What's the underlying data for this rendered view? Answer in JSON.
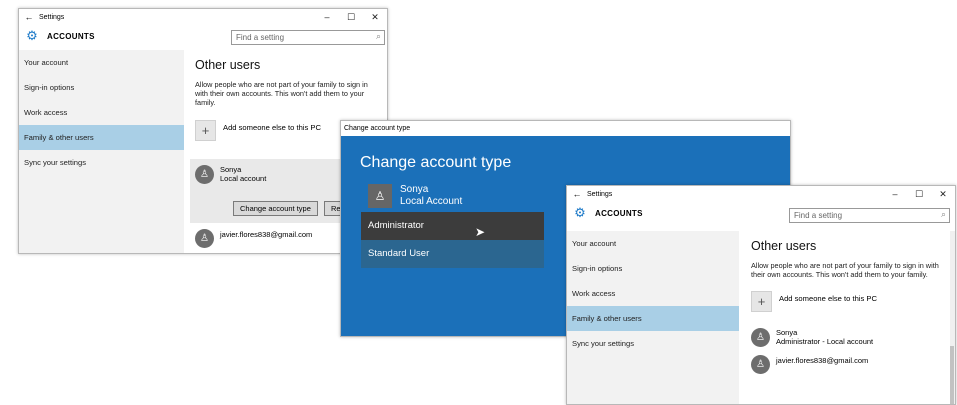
{
  "win1": {
    "title": "Settings",
    "back_glyph": "←",
    "minimize_glyph": "–",
    "maximize_glyph": "☐",
    "close_glyph": "✕",
    "app_title": "ACCOUNTS",
    "search_placeholder": "Find a setting",
    "nav": [
      "Your account",
      "Sign-in options",
      "Work access",
      "Family & other users",
      "Sync your settings"
    ],
    "heading": "Other users",
    "description": "Allow people who are not part of your family to sign in with their own accounts. This won't add them to your family.",
    "add_label": "Add someone else to this PC",
    "user1_name": "Sonya",
    "user1_sub": "Local account",
    "change_button": "Change account type",
    "remove_button": "Re",
    "user2_name": "javier.flores838@gmail.com"
  },
  "dialog": {
    "title": "Change account type",
    "heading": "Change account type",
    "user_name": "Sonya",
    "user_sub": "Local Account",
    "options": [
      "Administrator",
      "Standard User"
    ]
  },
  "win2": {
    "title": "Settings",
    "back_glyph": "←",
    "minimize_glyph": "–",
    "maximize_glyph": "☐",
    "close_glyph": "✕",
    "app_title": "ACCOUNTS",
    "search_placeholder": "Find a setting",
    "nav": [
      "Your account",
      "Sign-in options",
      "Work access",
      "Family & other users",
      "Sync your settings"
    ],
    "heading": "Other users",
    "description": "Allow people who are not part of your family to sign in with their own accounts. This won't add them to your family.",
    "add_label": "Add someone else to this PC",
    "user1_name": "Sonya",
    "user1_sub": "Administrator - Local account",
    "user2_name": "javier.flores838@gmail.com"
  },
  "colors": {
    "accent": "#1d7ac8",
    "dialog_bg": "#1b70b9",
    "selected_nav": "#a9cfe6",
    "dropdown_dark": "#3c3c3c",
    "dropdown_blue": "#2b6690"
  }
}
